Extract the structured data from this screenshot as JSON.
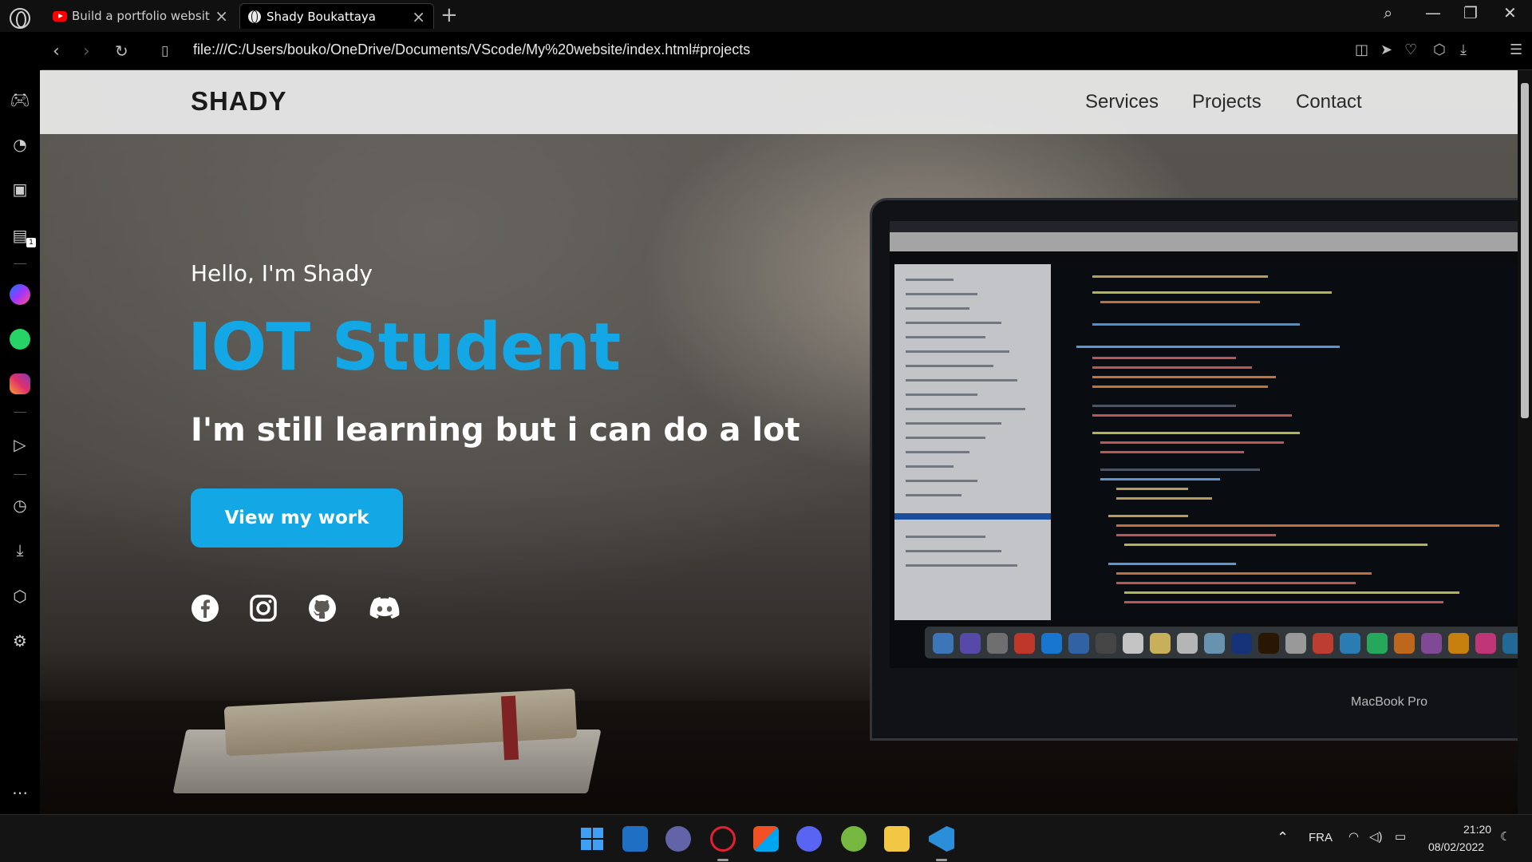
{
  "browser": {
    "tabs": [
      {
        "title": "Build a portfolio website us",
        "favicon": "youtube-icon"
      },
      {
        "title": "Shady Boukattaya",
        "favicon": "globe-icon"
      }
    ],
    "url": "file:///C:/Users/bouko/OneDrive/Documents/VScode/My%20website/index.html#projects",
    "sidebar_badge": "1"
  },
  "site": {
    "brand": "SHADY",
    "nav": [
      "Services",
      "Projects",
      "Contact"
    ],
    "greeting": "Hello, I'm Shady",
    "headline": "IOT Student",
    "tagline": "I'm still learning but i can do a lot",
    "cta": "View my work",
    "social": [
      "facebook-icon",
      "instagram-icon",
      "github-icon",
      "discord-icon"
    ],
    "laptop_label": "MacBook Pro",
    "accent_color": "#13a7e6"
  },
  "taskbar": {
    "language": "FRA",
    "time": "21:20",
    "date": "08/02/2022"
  }
}
